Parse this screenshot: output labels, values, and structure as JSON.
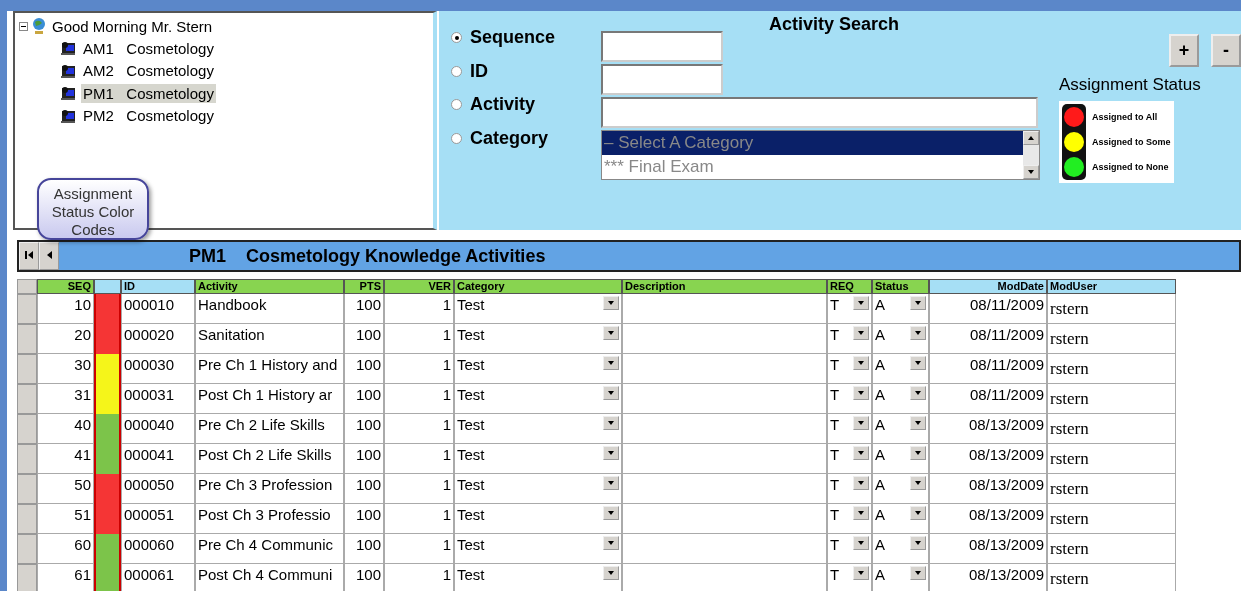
{
  "tree": {
    "root": {
      "label": "Good Morning Mr. Stern",
      "expanded": true,
      "children": [
        {
          "code": "AM1",
          "label": "Cosmetology",
          "selected": false
        },
        {
          "code": "AM2",
          "label": "Cosmetology",
          "selected": false
        },
        {
          "code": "PM1",
          "label": "Cosmetology",
          "selected": true
        },
        {
          "code": "PM2",
          "label": "Cosmetology",
          "selected": false
        }
      ]
    }
  },
  "search": {
    "title": "Activity Search",
    "options": [
      {
        "label": "Sequence",
        "selected": true,
        "kind": "short"
      },
      {
        "label": "ID",
        "selected": false,
        "kind": "short"
      },
      {
        "label": "Activity",
        "selected": false,
        "kind": "wide"
      },
      {
        "label": "Category",
        "selected": false,
        "kind": "list"
      }
    ],
    "category_list": [
      {
        "label": "– Select A Category",
        "selected": true
      },
      {
        "label": "*** Final Exam",
        "selected": false
      }
    ],
    "buttons": [
      "+",
      "-"
    ],
    "legend": {
      "title": "Assignment Status",
      "items": [
        {
          "label": "Assigned to All",
          "color": "#ff1a1a"
        },
        {
          "label": "Assigned to Some",
          "color": "#ffff00"
        },
        {
          "label": "Assigned to None",
          "color": "#22ee22"
        }
      ]
    }
  },
  "callout": "Assignment Status Color Codes",
  "banner": {
    "code": "PM1",
    "title": "Cosmetology Knowledge Activities"
  },
  "table": {
    "columns": [
      {
        "label": "SEQ",
        "color": "#88d450"
      },
      {
        "color": "#a6dff5"
      },
      {
        "label": "ID",
        "color": "#a6dff5"
      },
      {
        "label": "Activity",
        "color": "#88d450"
      },
      {
        "label": "PTS",
        "color": "#88d450"
      },
      {
        "label": "VER",
        "color": "#88d450"
      },
      {
        "label": "Category",
        "color": "#88d450"
      },
      {
        "label": "Description",
        "color": "#88d450"
      },
      {
        "label": "REQ",
        "color": "#88d450"
      },
      {
        "label": "Status",
        "color": "#88d450"
      },
      {
        "label": "ModDate",
        "color": "#a6dff5"
      },
      {
        "label": "ModUser",
        "color": "#a6dff5"
      }
    ],
    "rows": [
      {
        "seq": "10",
        "color": "#f53535",
        "id": "000010",
        "activity": "Handbook",
        "pts": "100",
        "ver": "1",
        "category": "Test",
        "req": "T",
        "status": "A",
        "mod_date": "08/11/2009",
        "mod_user": "rstern"
      },
      {
        "seq": "20",
        "color": "#f53535",
        "id": "000020",
        "activity": "Sanitation",
        "pts": "100",
        "ver": "1",
        "category": "Test",
        "req": "T",
        "status": "A",
        "mod_date": "08/11/2009",
        "mod_user": "rstern"
      },
      {
        "seq": "30",
        "color": "#f5f51a",
        "id": "000030",
        "activity": "Pre Ch 1 History and",
        "pts": "100",
        "ver": "1",
        "category": "Test",
        "req": "T",
        "status": "A",
        "mod_date": "08/11/2009",
        "mod_user": "rstern"
      },
      {
        "seq": "31",
        "color": "#f5f51a",
        "id": "000031",
        "activity": "Post Ch 1 History ar",
        "pts": "100",
        "ver": "1",
        "category": "Test",
        "req": "T",
        "status": "A",
        "mod_date": "08/11/2009",
        "mod_user": "rstern"
      },
      {
        "seq": "40",
        "color": "#7cc44a",
        "id": "000040",
        "activity": "Pre Ch 2 Life Skills",
        "pts": "100",
        "ver": "1",
        "category": "Test",
        "req": "T",
        "status": "A",
        "mod_date": "08/13/2009",
        "mod_user": "rstern"
      },
      {
        "seq": "41",
        "color": "#7cc44a",
        "id": "000041",
        "activity": "Post Ch 2 Life Skills",
        "pts": "100",
        "ver": "1",
        "category": "Test",
        "req": "T",
        "status": "A",
        "mod_date": "08/13/2009",
        "mod_user": "rstern"
      },
      {
        "seq": "50",
        "color": "#f53535",
        "id": "000050",
        "activity": "Pre Ch 3 Profession",
        "pts": "100",
        "ver": "1",
        "category": "Test",
        "req": "T",
        "status": "A",
        "mod_date": "08/13/2009",
        "mod_user": "rstern"
      },
      {
        "seq": "51",
        "color": "#f53535",
        "id": "000051",
        "activity": "Post Ch 3 Professio",
        "pts": "100",
        "ver": "1",
        "category": "Test",
        "req": "T",
        "status": "A",
        "mod_date": "08/13/2009",
        "mod_user": "rstern"
      },
      {
        "seq": "60",
        "color": "#7cc44a",
        "id": "000060",
        "activity": "Pre Ch 4 Communic",
        "pts": "100",
        "ver": "1",
        "category": "Test",
        "req": "T",
        "status": "A",
        "mod_date": "08/13/2009",
        "mod_user": "rstern"
      },
      {
        "seq": "61",
        "color": "#7cc44a",
        "id": "000061",
        "activity": "Post Ch 4 Communi",
        "pts": "100",
        "ver": "1",
        "category": "Test",
        "req": "T",
        "status": "A",
        "mod_date": "08/13/2009",
        "mod_user": "rstern"
      }
    ]
  }
}
